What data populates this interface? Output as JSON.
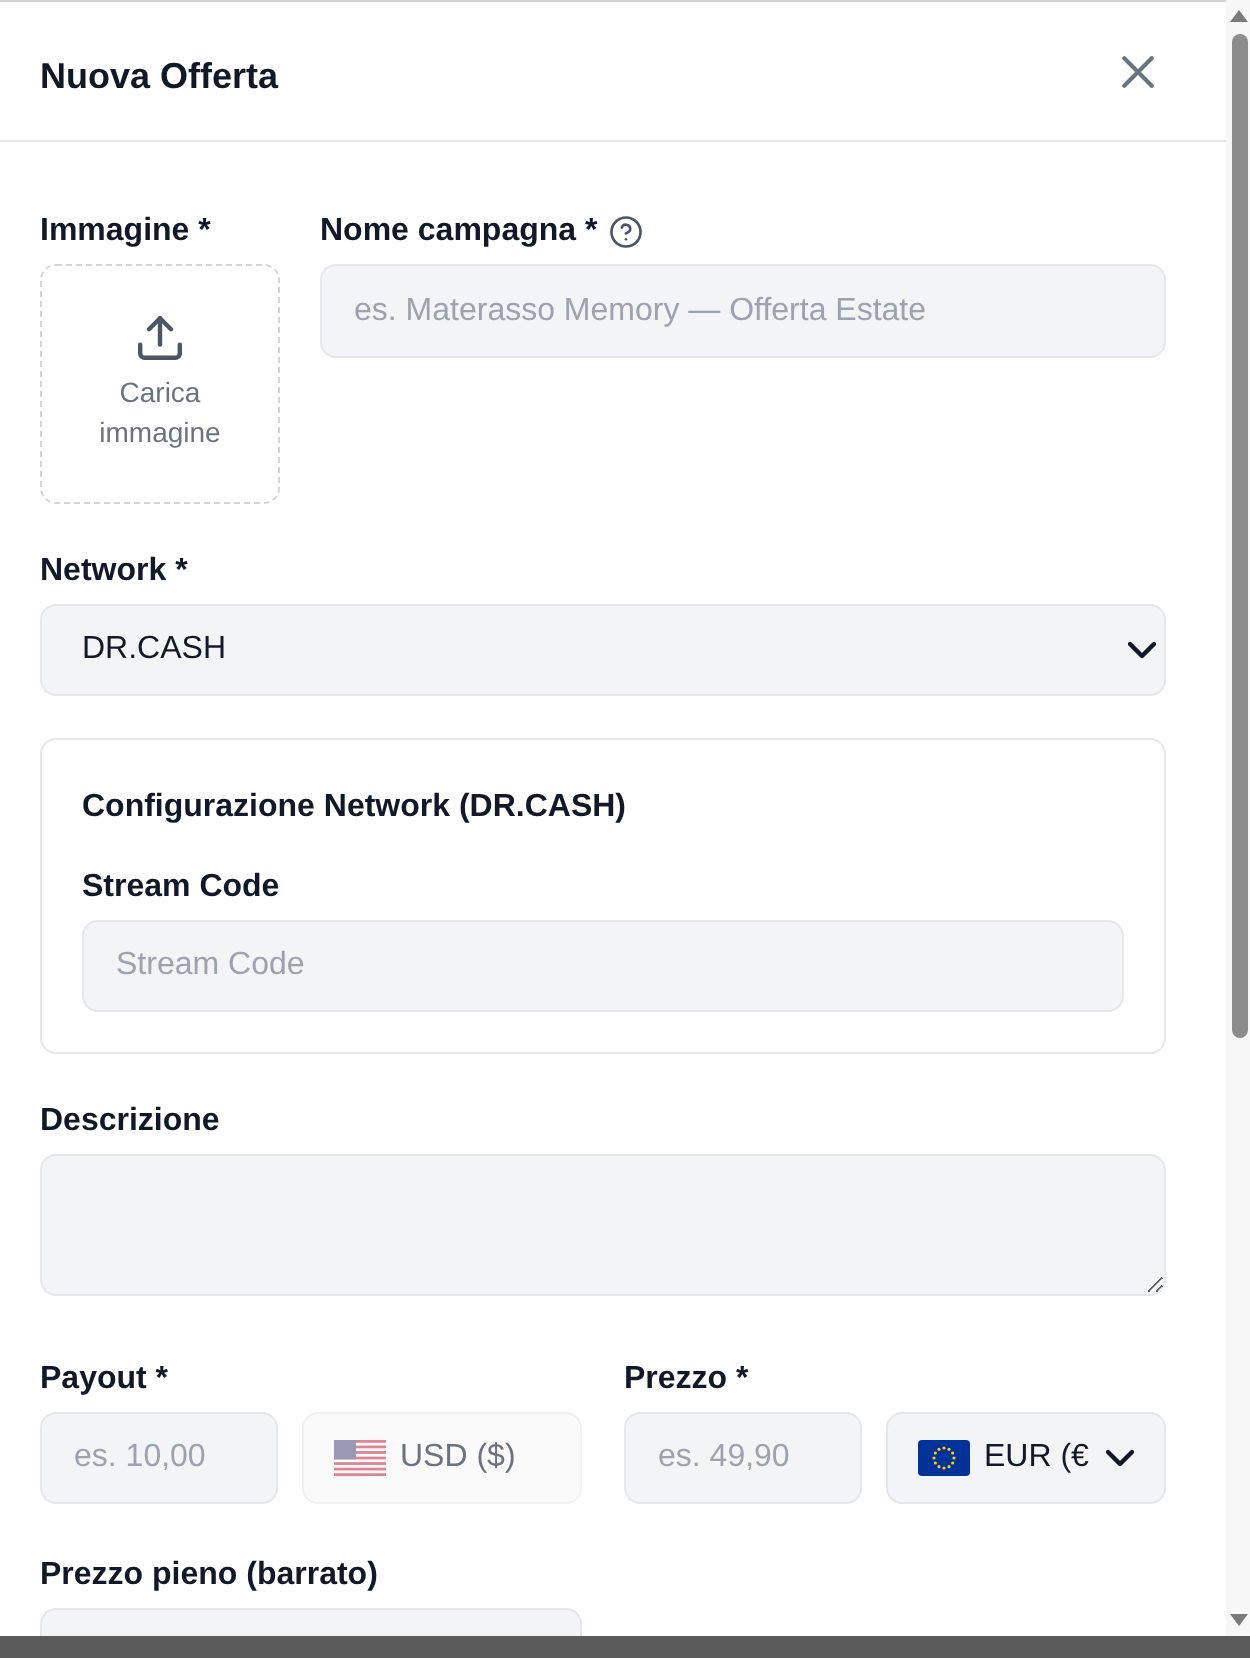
{
  "dialog": {
    "title": "Nuova Offerta"
  },
  "image_upload": {
    "label": "Immagine *",
    "text": "Carica immagine"
  },
  "campaign_name": {
    "label": "Nome campagna *",
    "placeholder": "es. Materasso Memory — Offerta Estate"
  },
  "network": {
    "label": "Network *",
    "value": "DR.CASH"
  },
  "network_config": {
    "title": "Configurazione Network (DR.CASH)",
    "fields": [
      {
        "label": "Stream Code",
        "placeholder": "Stream Code"
      }
    ]
  },
  "description": {
    "label": "Descrizione"
  },
  "price_groups": [
    {
      "label": "Payout *",
      "placeholder": "es. 10,00",
      "currency": {
        "kind": "us",
        "value": "USD ($)",
        "disabled": true
      }
    },
    {
      "label": "Prezzo *",
      "placeholder": "es. 49,90",
      "currency": {
        "kind": "eu",
        "value": "EUR (€",
        "disabled": false
      }
    }
  ],
  "full_price": {
    "label": "Prezzo pieno (barrato)"
  }
}
